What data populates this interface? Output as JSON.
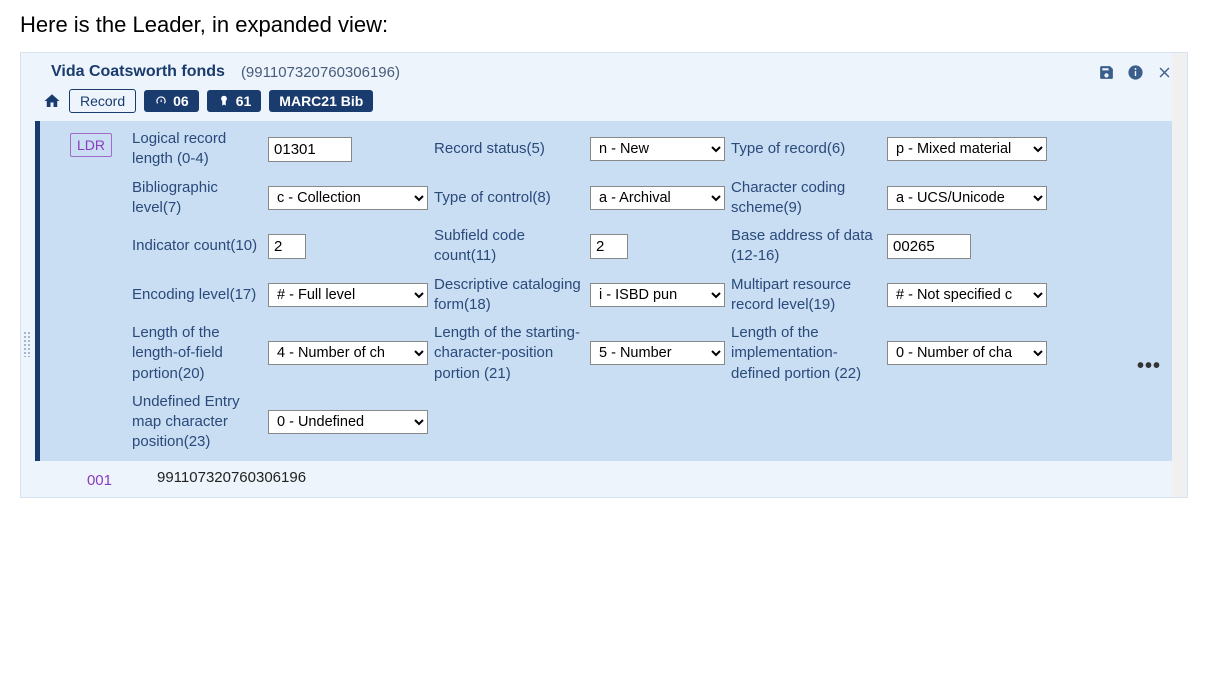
{
  "heading": "Here is the Leader, in expanded view:",
  "header": {
    "title": "Vida Coatsworth fonds",
    "id": "(991107320760306196)"
  },
  "toolbar": {
    "record": "Record",
    "badge1": "06",
    "badge2": "61",
    "format": "MARC21 Bib"
  },
  "ldr": {
    "tag": "LDR",
    "fields": [
      {
        "label": "Logical record length (0-4)",
        "kind": "input",
        "value": "01301",
        "wide": true
      },
      {
        "label": "Record status(5)",
        "kind": "select",
        "value": "n - New"
      },
      {
        "label": "Type of record(6)",
        "kind": "select",
        "value": "p - Mixed material"
      },
      {
        "label": "Bibliographic level(7)",
        "kind": "select",
        "value": "c - Collection"
      },
      {
        "label": "Type of control(8)",
        "kind": "select",
        "value": "a - Archival"
      },
      {
        "label": "Character coding scheme(9)",
        "kind": "select",
        "value": "a - UCS/Unicode"
      },
      {
        "label": "Indicator count(10)",
        "kind": "input",
        "value": "2",
        "small": true
      },
      {
        "label": "Subfield code count(11)",
        "kind": "input",
        "value": "2",
        "small": true
      },
      {
        "label": "Base address of data (12-16)",
        "kind": "input",
        "value": "00265",
        "wide": true
      },
      {
        "label": "Encoding level(17)",
        "kind": "select",
        "value": "# - Full level"
      },
      {
        "label": "Descriptive cataloging form(18)",
        "kind": "select",
        "value": "i - ISBD pun"
      },
      {
        "label": "Multipart resource record level(19)",
        "kind": "select",
        "value": "# - Not specified c"
      },
      {
        "label": "Length of the length-of-field portion(20)",
        "kind": "select",
        "value": "4 - Number of ch"
      },
      {
        "label": "Length of the starting-character-position portion (21)",
        "kind": "select",
        "value": "5 - Number"
      },
      {
        "label": "Length of the implementation-defined portion (22)",
        "kind": "select",
        "value": "0 - Number of cha"
      },
      {
        "label": "Undefined Entry map character position(23)",
        "kind": "select",
        "value": "0 - Undefined"
      }
    ]
  },
  "row001": {
    "tag": "001",
    "value": "991107320760306196"
  }
}
